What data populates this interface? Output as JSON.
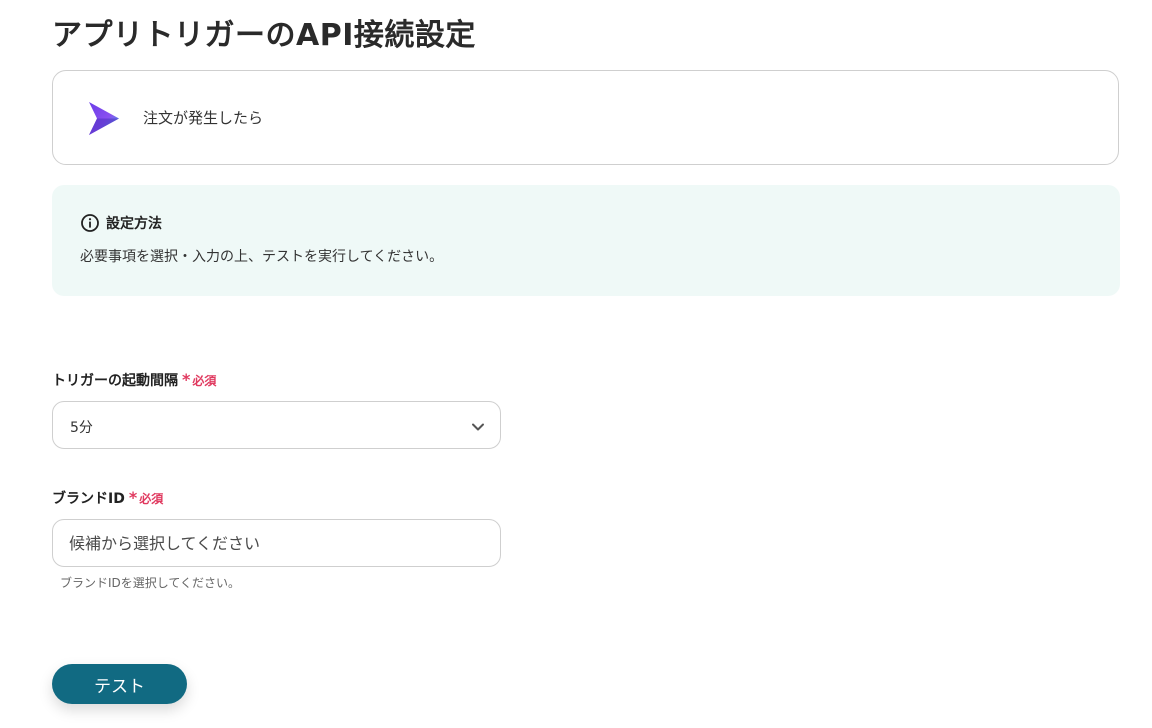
{
  "page": {
    "title": "アプリトリガーのAPI接続設定"
  },
  "trigger": {
    "label": "注文が発生したら",
    "logo_icon": "play-triangle-logo-icon"
  },
  "info": {
    "icon": "info-circle-icon",
    "title": "設定方法",
    "text": "必要事項を選択・入力の上、テストを実行してください。",
    "background_color": "#eff9f7"
  },
  "interval_field": {
    "label": "トリガーの起動間隔",
    "required_mark": "*",
    "required_text": "必須",
    "selected_value": "5分",
    "chevron_icon": "chevron-down-icon"
  },
  "brand_field": {
    "label": "ブランドID",
    "required_mark": "*",
    "required_text": "必須",
    "placeholder": "候補から選択してください",
    "help_text": "ブランドIDを選択してください。"
  },
  "actions": {
    "test_label": "テスト",
    "button_color": "#116a82"
  },
  "colors": {
    "required": "#e0395f",
    "border": "#cfcfcf"
  }
}
